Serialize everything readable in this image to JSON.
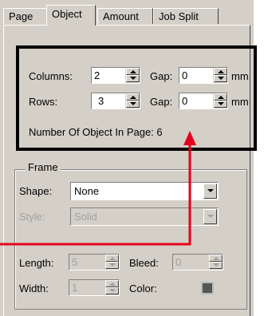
{
  "tabs": [
    "Page",
    "Object",
    "Amount",
    "Job Split"
  ],
  "active_tab": "Object",
  "layout": {
    "columns_label": "Columns:",
    "columns_value": "2",
    "rows_label": "Rows:",
    "rows_value": "3",
    "gap_label": "Gap:",
    "col_gap_value": "0",
    "row_gap_value": "0",
    "unit": "mm",
    "count_text": "Number Of Object In Page: 6"
  },
  "frame": {
    "title": "Frame",
    "shape_label": "Shape:",
    "shape_value": "None",
    "style_label": "Style:",
    "style_value": "Solid",
    "length_label": "Length:",
    "length_value": "5",
    "bleed_label": "Bleed:",
    "bleed_value": "0",
    "width_label": "Width:",
    "width_value": "1",
    "color_label": "Color:"
  },
  "colors": {
    "annotation": "#e4001c",
    "panel": "#d4d0c8"
  }
}
